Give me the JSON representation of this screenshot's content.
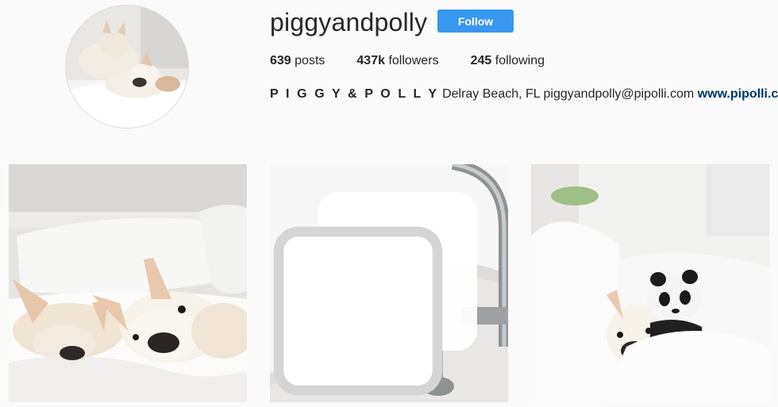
{
  "profile": {
    "username": "piggyandpolly",
    "follow_label": "Follow",
    "stats": {
      "posts_count": "639",
      "posts_label": "posts",
      "followers_count": "437k",
      "followers_label": "followers",
      "following_count": "245",
      "following_label": "following"
    },
    "bio": {
      "full_name": "P I G G Y & P O L L Y",
      "location": "Delray Beach, FL",
      "email": "piggyandpolly@pipolli.com",
      "website": "www.pipolli.com"
    },
    "avatar_icon": "profile-avatar-photo"
  },
  "colors": {
    "accent": "#3897f0",
    "link": "#003569",
    "text": "#262626",
    "background": "#fafafa"
  },
  "posts": [
    {
      "icon": "photo-two-dogs-in-bed"
    },
    {
      "icon": "photo-dog-in-bathtub",
      "badge_icon": "multiple-photos-icon"
    },
    {
      "icon": "photo-dog-with-panda-plush"
    }
  ]
}
